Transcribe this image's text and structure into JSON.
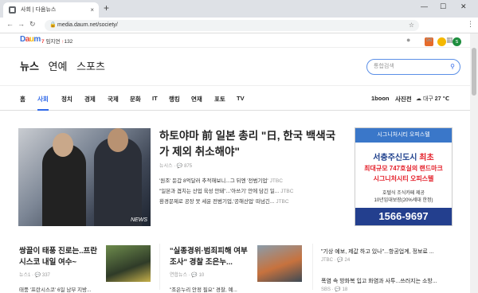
{
  "browser": {
    "tab_title": "사회 | 다음뉴스",
    "tab_close": "×",
    "new_tab": "+",
    "url": "media.daum.net/society/",
    "win_min": "—",
    "win_max": "☐",
    "win_close": "✕",
    "avatar_letter": "s"
  },
  "daum": {
    "logo": "Daum",
    "alert_count": "7",
    "alert_label": "임지연",
    "alert_trend": "132"
  },
  "gnb": {
    "news": "뉴스",
    "entertainment": "연예",
    "sports": "스포츠",
    "search_placeholder": "통합검색"
  },
  "menu": {
    "items": [
      "홈",
      "사회",
      "정치",
      "경제",
      "국제",
      "문화",
      "IT",
      "랭킹",
      "연재",
      "포토",
      "TV"
    ],
    "extra": [
      "1boon",
      "사진전"
    ],
    "weather_location": "대구",
    "weather_temp": "27 ℃"
  },
  "headline": {
    "title": "하토야마 前 일본 총리 \"日, 한국 백색국가 제외 취소해야\"",
    "source": "뉴시스",
    "comments": "875",
    "photo_mark": "NEWS",
    "subs": [
      {
        "text": "'원조' 둔갑 8억달러 추적해보니...그 뒤엔 '전범기업'",
        "src": "JTBC"
      },
      {
        "text": "\"일본과 겹치는 산업 육성 안돼\"...'아쓰기' 안에 담긴 일...",
        "src": "JTBC"
      },
      {
        "text": "환경문제로 공장 못 세운 전범기업,'공해산업' 떠넘긴...",
        "src": "JTBC"
      }
    ]
  },
  "ad": {
    "top": "시그니처시티 오피스텔",
    "line1a": "서충주신도시",
    "line1b": "최초",
    "line2": "최대규모 747호실의 랜드마크",
    "line3": "시그니처시티 오피스텔",
    "line4": "호텔식 조식카페 제공",
    "line5": "10년임대보장(20%세대 한정)",
    "phone": "1566-9697"
  },
  "cards": [
    {
      "title": "쌍끌이 태풍 진로는..프란시스코 내일 여수~",
      "src": "뉴스1",
      "comments": "337",
      "more": "태풍 '프란시스코' 6일 남부 지방..."
    },
    {
      "title": "\"실종경위·범죄피해 여부조사\" 경찰 조은누...",
      "src": "연합뉴스",
      "comments": "10",
      "more": "\"조은누리 안정 필요\" 경찰, 예..."
    }
  ],
  "right": [
    {
      "text": "\"기상 예보, 제값 하고 있나\"...항공업계, 정보료 ...",
      "src": "JTBC",
      "comments": "24"
    },
    {
      "text": "폭염 속 방화복 입고 화염과 사투...쓰러지는 소방...",
      "src": "SBS",
      "comments": "18"
    }
  ]
}
